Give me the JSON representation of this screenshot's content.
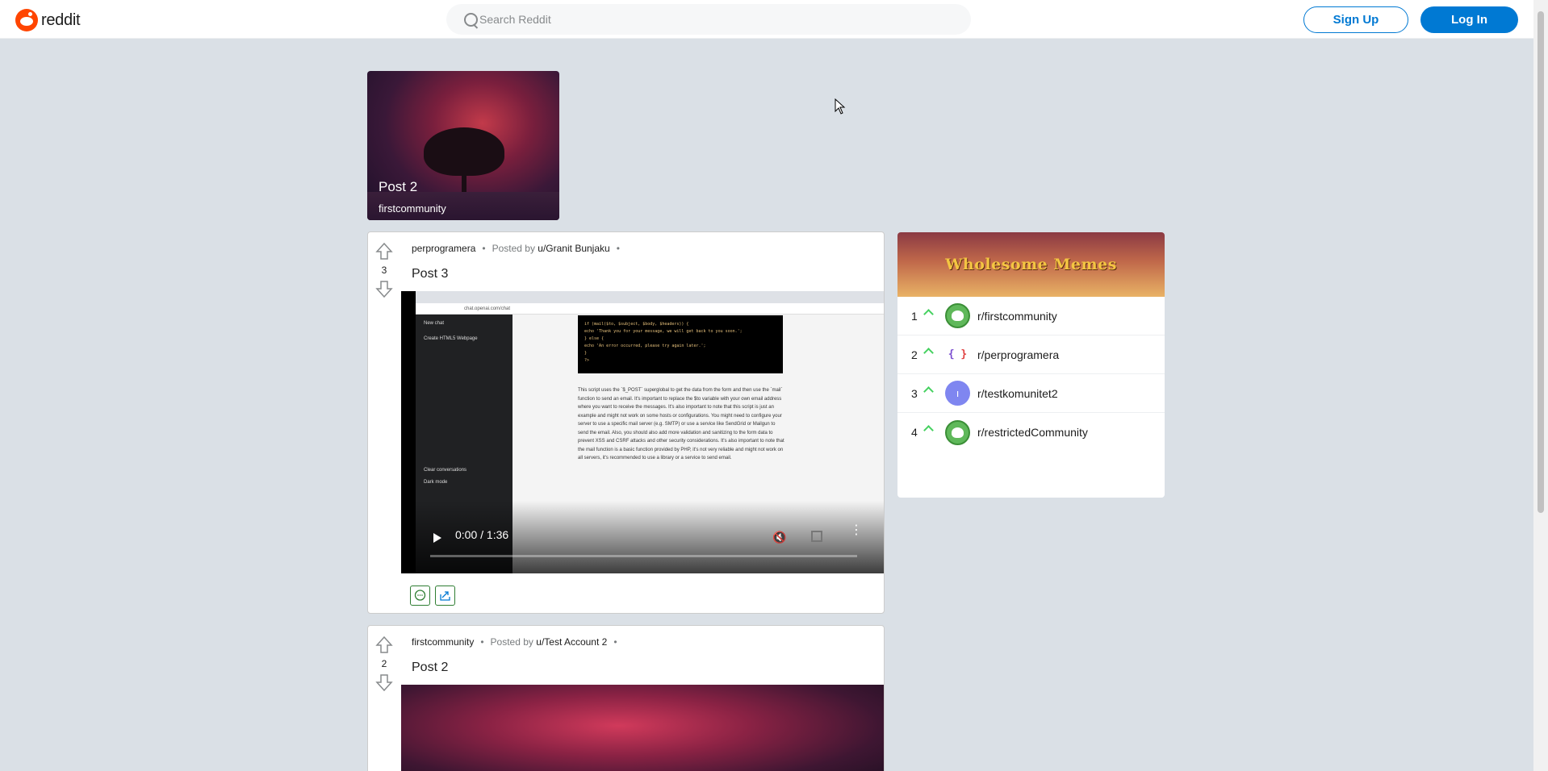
{
  "header": {
    "logo_text": "reddit",
    "search_placeholder": "Search Reddit",
    "signup_label": "Sign Up",
    "login_label": "Log In"
  },
  "trending": {
    "title": "Post 2",
    "community": "firstcommunity"
  },
  "posts": [
    {
      "votes": "3",
      "community": "perprogramera",
      "posted_by_label": "Posted by",
      "author": "u/Granit Bunjaku",
      "title": "Post 3",
      "video_time": "0:00 / 1:36"
    },
    {
      "votes": "2",
      "community": "firstcommunity",
      "posted_by_label": "Posted by",
      "author": "u/Test Account 2",
      "title": "Post 2"
    }
  ],
  "sidebar": {
    "banner_title": "Wholesome Memes",
    "communities": [
      {
        "rank": "1",
        "name": "r/firstcommunity",
        "avatar": "green-snoo"
      },
      {
        "rank": "2",
        "name": "r/perprogramera",
        "avatar": "code-braces"
      },
      {
        "rank": "3",
        "name": "r/testkomunitet2",
        "avatar": "purple-letter"
      },
      {
        "rank": "4",
        "name": "r/restrictedCommunity",
        "avatar": "green-snoo"
      }
    ]
  },
  "colors": {
    "background": "#dae0e6",
    "brand": "#ff4500",
    "primary": "#0079d3",
    "trend_up": "#46d160"
  },
  "video_content": {
    "sidebar_items": [
      "New chat",
      "Create HTML5 Webpage",
      "Clear conversations",
      "Dark mode"
    ],
    "code_lines": [
      "if (mail($to, $subject, $body, $headers)) {",
      "  echo 'Thank you for your message, we will get back to you soon.';",
      "} else {",
      "  echo 'An error occurred, please try again later.';",
      "}",
      "?>"
    ],
    "text": "This script uses the `$_POST` superglobal to get the data from the form and then use the `mail` function to send an email. It's important to replace the $to variable with your own email address where you want to receive the messages. It's also important to note that this script is just an example and might not work on some hosts or configurations. You might need to configure your server to use a specific mail server (e.g. SMTP) or use a service like SendGrid or Mailgun to send the email. Also, you should also add more validation and sanitizing to the form data to prevent XSS and CSRF attacks and other security considerations. It's also important to note that the mail function is a basic function provided by PHP, it's not very reliable and might not work on all servers, it's recommended to use a library or a service to send email.",
    "url": "chat.openai.com/chat"
  }
}
